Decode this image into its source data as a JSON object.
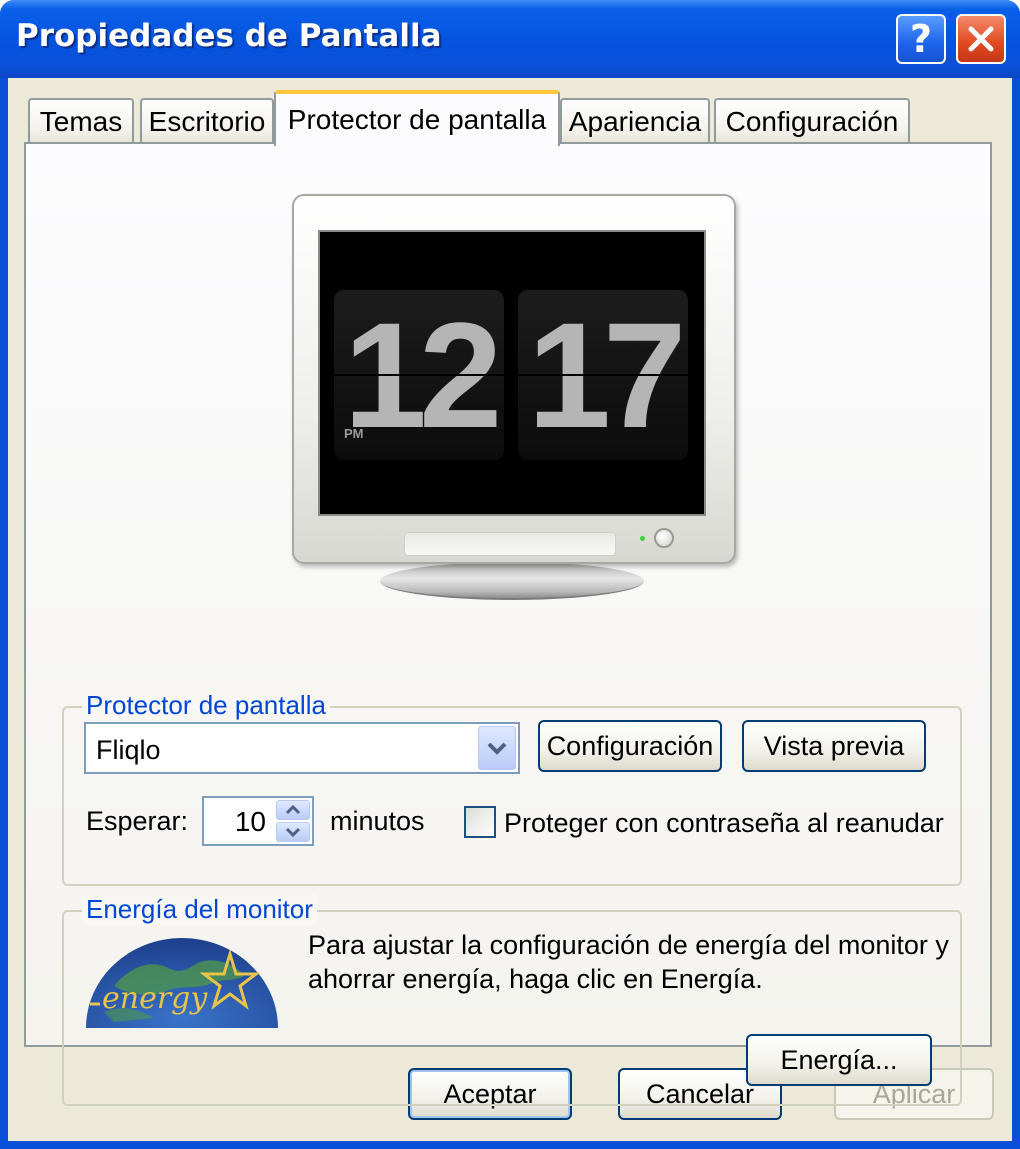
{
  "window": {
    "title": "Propiedades de Pantalla",
    "help_label": "?"
  },
  "tabs": [
    {
      "label": "Temas"
    },
    {
      "label": "Escritorio"
    },
    {
      "label": "Protector de pantalla",
      "active": true
    },
    {
      "label": "Apariencia"
    },
    {
      "label": "Configuración"
    }
  ],
  "preview": {
    "hours": "12",
    "minutes": "17",
    "ampm": "PM"
  },
  "screensaver": {
    "group_label": "Protector de pantalla",
    "selected": "Fliqlo",
    "settings_button": "Configuración",
    "preview_button": "Vista previa",
    "wait_label": "Esperar:",
    "wait_value": "10",
    "wait_unit": "minutos",
    "password_label": "Proteger con contraseña al reanudar",
    "password_checked": false
  },
  "monitor_power": {
    "group_label": "Energía del monitor",
    "logo_text": "energy",
    "description": "Para ajustar la configuración de energía del monitor y ahorrar energía, haga clic en Energía.",
    "power_button": "Energía..."
  },
  "footer": {
    "ok": "Aceptar",
    "cancel": "Cancelar",
    "apply": "Aplicar"
  },
  "colors": {
    "title_bar": "#0a4fd8",
    "group_label": "#0046d5",
    "face": "#ece9d8",
    "active_tab_accent": "#ffc83c"
  }
}
